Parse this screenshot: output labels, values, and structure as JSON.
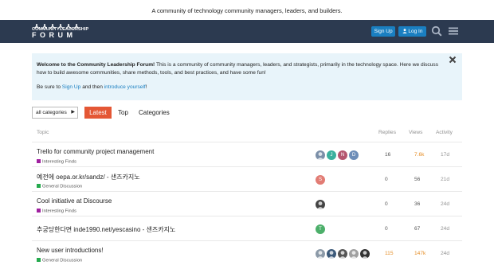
{
  "tagline": "A community of technology community managers, leaders, and builders.",
  "header": {
    "logo_line1": "COMMUNITYLEADERSHIP",
    "logo_line2": "FORUM",
    "signup_label": "Sign Up",
    "login_label": "Log In",
    "bg_color": "#2c3a50",
    "button_color": "#1a7fc1"
  },
  "banner": {
    "bold": "Welcome to the Community Leadership Forum!",
    "text1": " This is a community of community managers, leaders, and strategists, primarily in the technology space. Here we discuss how to build awesome communities, share methods, tools, and best practices, and have some fun!",
    "p2_before": "Be sure to ",
    "p2_link1": "Sign Up",
    "p2_middle": " and then ",
    "p2_link2": "introduce yourself",
    "p2_after": "!"
  },
  "nav": {
    "category_dropdown": "all categories",
    "tabs": [
      "Latest",
      "Top",
      "Categories"
    ],
    "active_color": "#e45735"
  },
  "columns": {
    "topic": "Topic",
    "replies": "Replies",
    "views": "Views",
    "activity": "Activity"
  },
  "topics": [
    {
      "title": "Trello for community project management",
      "category": "Interesting Finds",
      "category_color": "#a020a0",
      "posters": [
        "photo",
        "J",
        "N",
        "D"
      ],
      "poster_colors": [
        "#7b8fa8",
        "#3ab09e",
        "#b4556f",
        "#6d8db8"
      ],
      "replies": "16",
      "views": "7.6k",
      "activity": "17d"
    },
    {
      "title": "예전에 oepa.or.kr/sandz/ - 샌즈카지노",
      "category": "General Discussion",
      "category_color": "#25aa4e",
      "posters": [
        "S"
      ],
      "poster_colors": [
        "#e27c74"
      ],
      "replies": "0",
      "views": "56",
      "activity": "21d"
    },
    {
      "title": "Cool initiative at Discourse",
      "category": "Interesting Finds",
      "category_color": "#a020a0",
      "posters": [
        "photo"
      ],
      "poster_colors": [
        "#444444"
      ],
      "replies": "0",
      "views": "36",
      "activity": "24d"
    },
    {
      "title": "추궁당한다면 inde1990.net/yescasino - 샌즈카지노",
      "category": "",
      "category_color": "",
      "posters": [
        "T"
      ],
      "poster_colors": [
        "#4caf6a"
      ],
      "replies": "0",
      "views": "67",
      "activity": "24d"
    },
    {
      "title": "New user introductions!",
      "category": "General Discussion",
      "category_color": "#25aa4e",
      "posters": [
        "photo",
        "photo",
        "photo",
        "photo",
        "photo"
      ],
      "poster_colors": [
        "#8c9aa8",
        "#3c5a7a",
        "#555555",
        "#a0a0a0",
        "#333333"
      ],
      "replies": "115",
      "views": "147k",
      "activity": "24d"
    }
  ]
}
